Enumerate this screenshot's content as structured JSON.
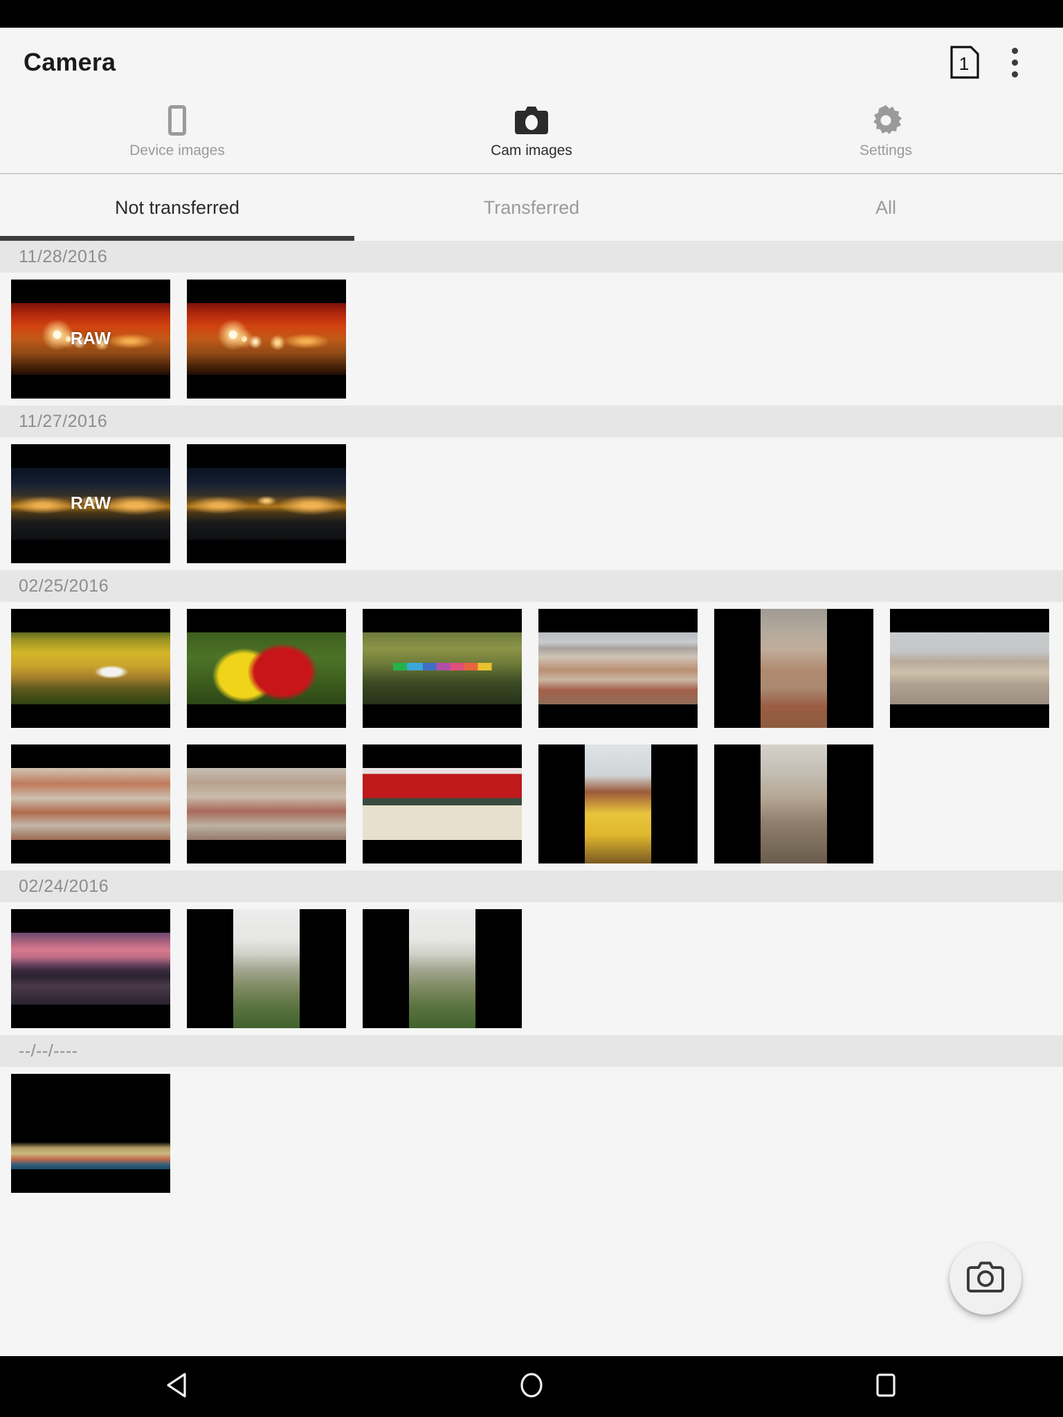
{
  "app": {
    "title": "Camera",
    "page_badge_count": "1",
    "overflow_menu_label": "More options"
  },
  "main_tabs": [
    {
      "label": "Device images",
      "icon": "device-phone-icon",
      "active": false
    },
    {
      "label": "Cam images",
      "icon": "camera-icon",
      "active": true
    },
    {
      "label": "Settings",
      "icon": "gear-icon",
      "active": false
    }
  ],
  "sub_tabs": [
    {
      "label": "Not transferred",
      "active": true
    },
    {
      "label": "Transferred",
      "active": false
    },
    {
      "label": "All",
      "active": false
    }
  ],
  "fab": {
    "icon": "camera-outline-icon",
    "label": "Take picture"
  },
  "nav_bar": [
    {
      "label": "Back",
      "icon": "back-triangle-icon"
    },
    {
      "label": "Home",
      "icon": "home-circle-icon"
    },
    {
      "label": "Recents",
      "icon": "recents-square-icon"
    }
  ],
  "raw_badge_label": "RAW",
  "groups": [
    {
      "date": "11/28/2016",
      "thumbs": [
        {
          "scene": "sc-restaurant",
          "orientation": "landscape",
          "raw": true
        },
        {
          "scene": "sc-restaurant",
          "orientation": "landscape",
          "raw": false
        }
      ]
    },
    {
      "date": "11/27/2016",
      "thumbs": [
        {
          "scene": "sc-night-river",
          "orientation": "landscape",
          "raw": true
        },
        {
          "scene": "sc-night-river",
          "orientation": "landscape",
          "raw": false
        }
      ]
    },
    {
      "date": "02/25/2016",
      "thumbs": [
        {
          "scene": "sc-autumn-umbrella",
          "orientation": "landscape",
          "raw": false
        },
        {
          "scene": "sc-leaves",
          "orientation": "landscape",
          "raw": false
        },
        {
          "scene": "sc-rainbow-umbrella",
          "orientation": "landscape",
          "raw": false
        },
        {
          "scene": "sc-city-wide",
          "orientation": "landscape",
          "raw": false
        },
        {
          "scene": "sc-city-spire",
          "orientation": "portrait",
          "raw": false
        },
        {
          "scene": "sc-city-cranes",
          "orientation": "landscape",
          "raw": false
        },
        {
          "scene": "sc-city-roofs1",
          "orientation": "landscape",
          "raw": false
        },
        {
          "scene": "sc-city-roofs2",
          "orientation": "landscape",
          "raw": false
        },
        {
          "scene": "sc-red-wall",
          "orientation": "landscape",
          "raw": false
        },
        {
          "scene": "sc-yellow-house",
          "orientation": "portrait",
          "raw": false
        },
        {
          "scene": "sc-alley",
          "orientation": "portrait",
          "raw": false
        }
      ]
    },
    {
      "date": "02/24/2016",
      "thumbs": [
        {
          "scene": "sc-sunset-river",
          "orientation": "landscape",
          "raw": false
        },
        {
          "scene": "sc-misty-city",
          "orientation": "portrait",
          "raw": false
        },
        {
          "scene": "sc-misty-city",
          "orientation": "portrait",
          "raw": false
        }
      ]
    },
    {
      "date": "--/--/----",
      "thumbs": [
        {
          "scene": "sc-last",
          "orientation": "landscape",
          "raw": false
        }
      ]
    }
  ],
  "colors": {
    "app_bg": "#f5f5f5",
    "date_header_bg": "#e6e6e6",
    "date_header_text": "#8d8d8d",
    "active_text": "#2b2b2b",
    "inactive_text": "#9a9a9a",
    "indicator": "#3c3c3c",
    "nav_bar_bg": "#000000"
  }
}
